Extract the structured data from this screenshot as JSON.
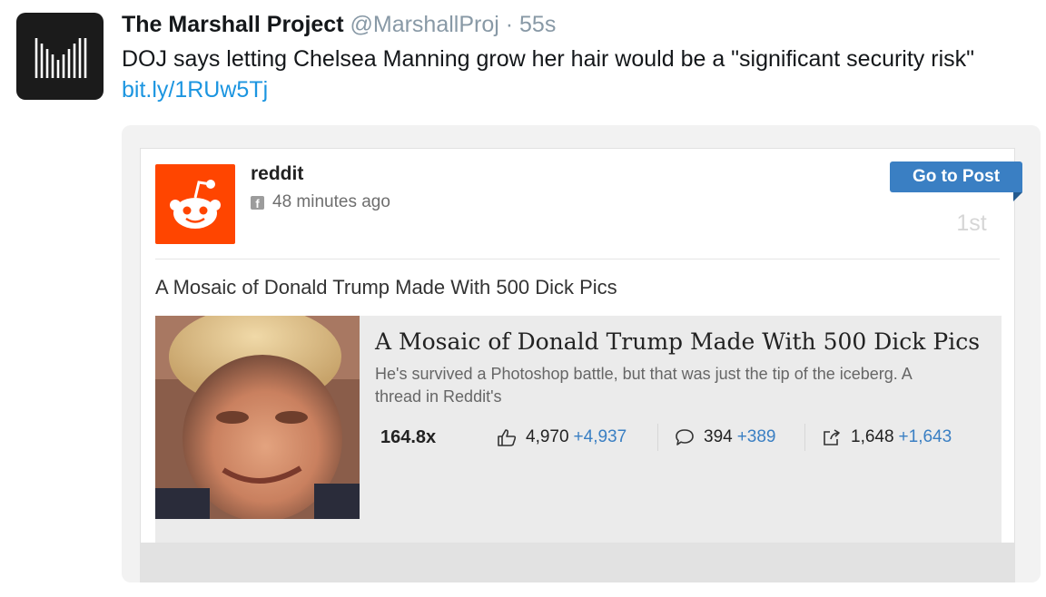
{
  "tweet": {
    "author": "The Marshall Project",
    "handle": "@MarshallProj",
    "separator": "·",
    "time": "55s",
    "text": "DOJ says letting Chelsea Manning grow her hair would be a \"significant security risk\" ",
    "link": "bit.ly/1RUw5Tj",
    "avatar_icon": "marshall-project-logo"
  },
  "card": {
    "source": "reddit",
    "source_icon": "reddit-alien-icon",
    "meta_icon": "facebook-icon",
    "meta_icon_glyph": "f",
    "time_ago": "48 minutes ago",
    "go_button": "Go to Post",
    "rank": "1st",
    "post_title": "A Mosaic of Donald Trump Made With 500 Dick Pics"
  },
  "preview": {
    "title": "A Mosaic of Donald Trump Made With 500 Dick Pics",
    "description": "He's survived a Photoshop battle, but that was just the tip of the iceberg. A thread in Reddit's",
    "score": "164.8x",
    "likes": "4,970",
    "likes_delta": "+4,937",
    "comments": "394",
    "comments_delta": "+389",
    "shares": "1,648",
    "shares_delta": "+1,643",
    "thumbnail_icon": "mosaic-portrait-image"
  },
  "colors": {
    "link": "#1b95e0",
    "reddit": "#ff4500",
    "button": "#3a7fc3",
    "delta": "#3a7fc3"
  }
}
